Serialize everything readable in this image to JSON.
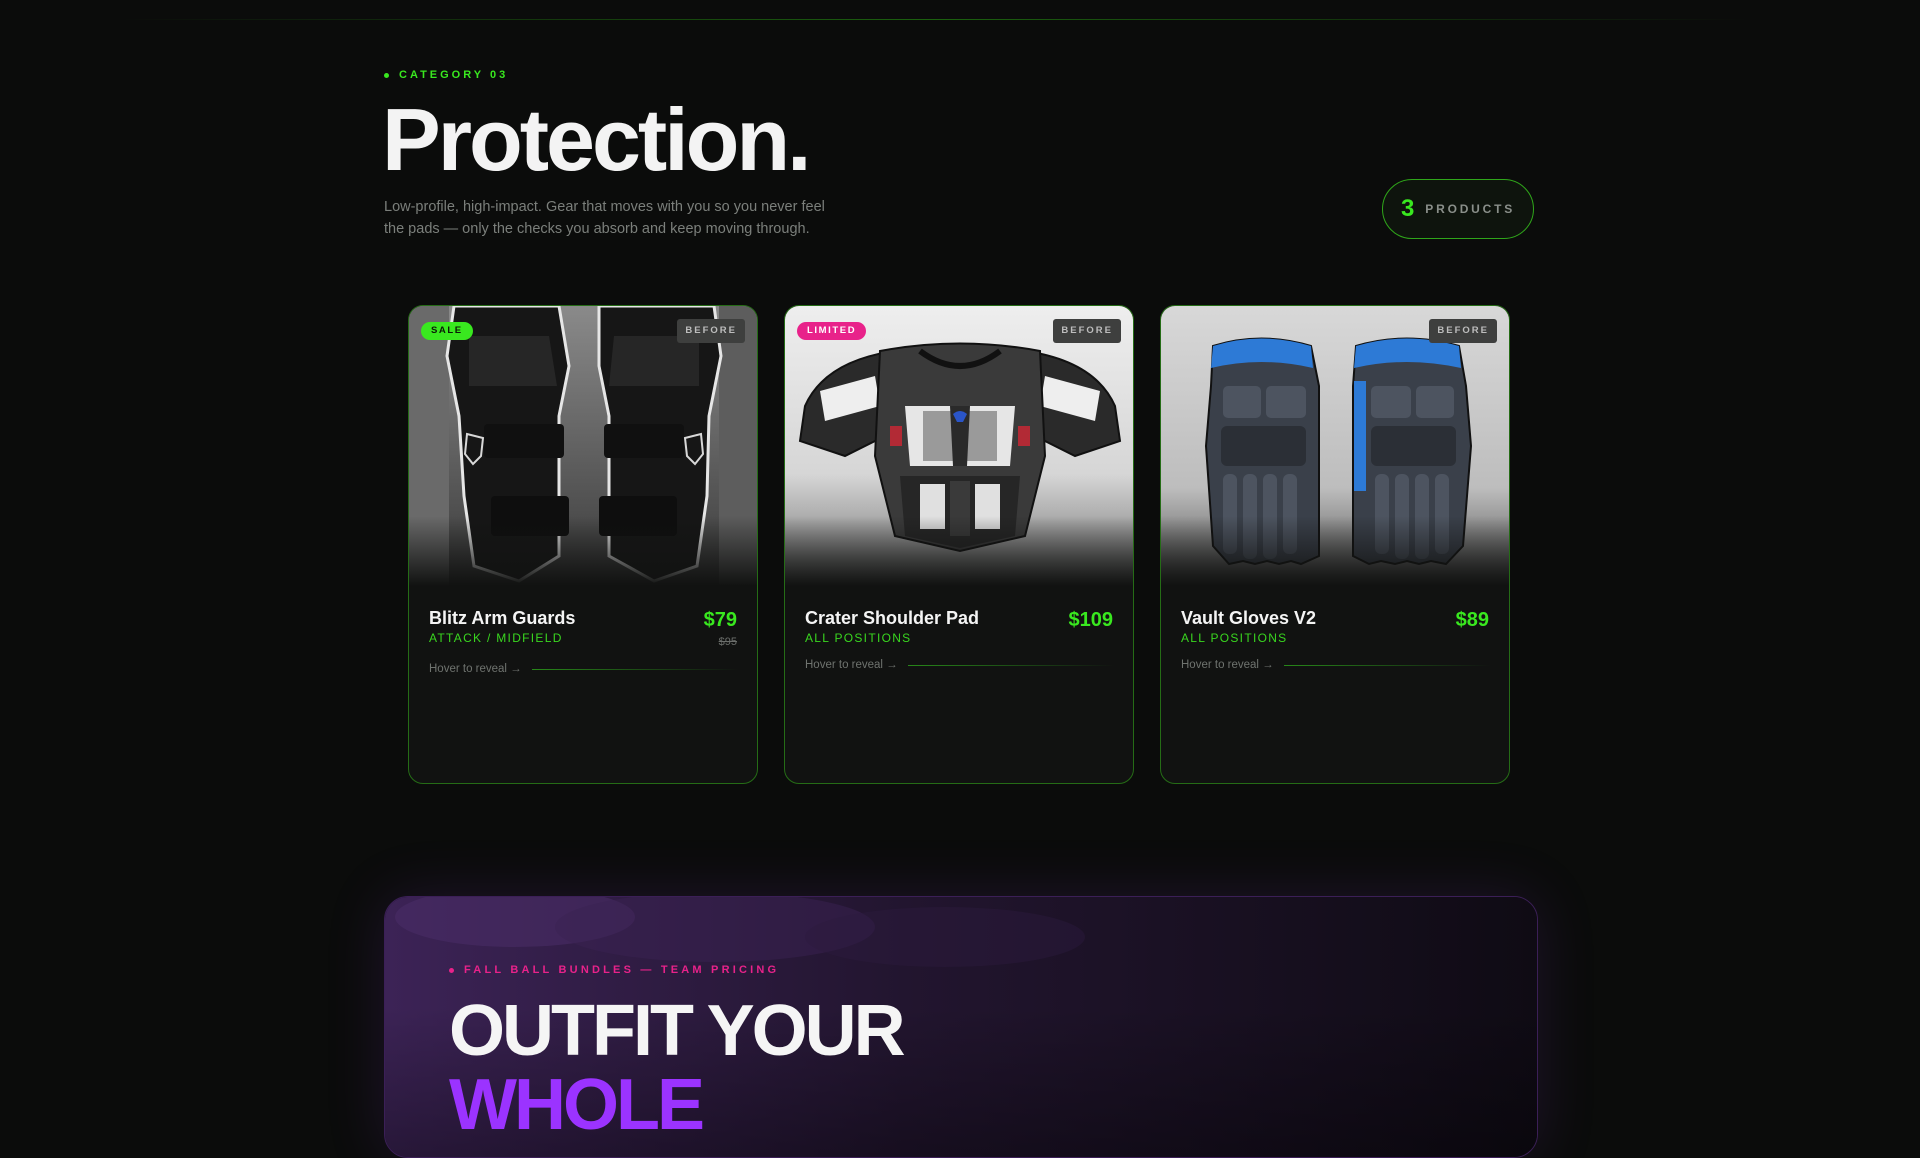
{
  "section": {
    "eyebrow": "CATEGORY 03",
    "title": "Protection.",
    "description_line1": "Low-profile, high-impact. Gear that moves with you so you never feel",
    "description_line2": "the pads — only the checks you absorb and keep moving through.",
    "count_number": "3",
    "count_label": "PRODUCTS"
  },
  "products": [
    {
      "badge": "SALE",
      "before_label": "BEFORE",
      "name": "Blitz Arm Guards",
      "position": "ATTACK / MIDFIELD",
      "price": "$79",
      "old_price": "$95",
      "hover_text": "Hover to reveal →"
    },
    {
      "badge": "LIMITED",
      "before_label": "BEFORE",
      "name": "Crater Shoulder Pad",
      "position": "ALL POSITIONS",
      "price": "$109",
      "hover_text": "Hover to reveal →"
    },
    {
      "badge": "",
      "before_label": "BEFORE",
      "name": "Vault Gloves V2",
      "position": "ALL POSITIONS",
      "price": "$89",
      "hover_text": "Hover to reveal →"
    }
  ],
  "promo": {
    "eyebrow": "FALL BALL BUNDLES — TEAM PRICING",
    "title_line1": "OUTFIT YOUR",
    "title_line2": "WHOLE"
  },
  "colors": {
    "accent_green": "#39e81f",
    "accent_pink": "#e8228a",
    "accent_purple": "#9b33ff",
    "background": "#0b0c0b"
  },
  "icons": {
    "eyebrow_dot": "dot-icon",
    "arrow": "arrow-right-icon"
  }
}
